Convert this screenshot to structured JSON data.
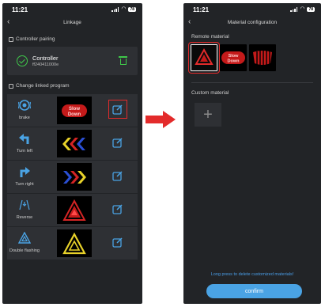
{
  "left": {
    "status": {
      "time": "11:21",
      "battery": "78"
    },
    "nav": {
      "back": "‹",
      "title": "Linkage"
    },
    "pairing": {
      "section_label": "Controller pairing",
      "controller_name": "Controller",
      "controller_id": "ff240411000e"
    },
    "programs": {
      "section_label": "Change linked program",
      "items": [
        {
          "label": "brake",
          "thumb_text": "Slow Down",
          "icon": "brake-icon"
        },
        {
          "label": "Turn left",
          "icon": "arrow-left-icon"
        },
        {
          "label": "Turn right",
          "icon": "arrow-right-icon"
        },
        {
          "label": "Reverse",
          "icon": "reverse-icon"
        },
        {
          "label": "Double flashing",
          "icon": "hazard-icon"
        }
      ]
    }
  },
  "right": {
    "status": {
      "time": "11:21",
      "battery": "78"
    },
    "nav": {
      "back": "‹",
      "title": "Material configuration"
    },
    "remote": {
      "section_label": "Remote material",
      "tile2_text": "Slow Down"
    },
    "custom": {
      "section_label": "Custom material",
      "add": "+"
    },
    "hint": "Long press to delete customized materials!",
    "confirm": "confirm"
  },
  "colors": {
    "bg": "#222427",
    "card": "#2e3034",
    "accent_green": "#3fc84a",
    "accent_blue": "#4aa3e4",
    "highlight_red": "#e32b2b"
  }
}
